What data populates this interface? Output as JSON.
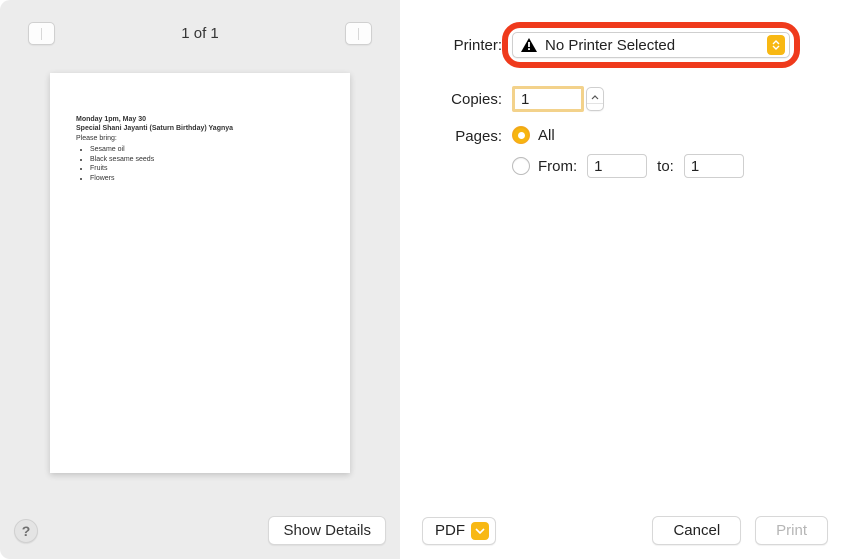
{
  "preview": {
    "page_indicator": "1 of 1",
    "page_content": {
      "line1": "Monday 1pm, May 30",
      "line2": "Special Shani Jayanti (Saturn Birthday) Yagnya",
      "line3": "Please bring:",
      "bullets": [
        "Sesame oil",
        "Black sesame seeds",
        "Fruits",
        "Flowers"
      ]
    }
  },
  "footer_left": {
    "help_symbol": "?",
    "show_details_label": "Show Details"
  },
  "settings": {
    "printer_label": "Printer:",
    "printer_value": "No Printer Selected",
    "copies_label": "Copies:",
    "copies_value": "1",
    "pages_label": "Pages:",
    "pages_all_label": "All",
    "pages_from_label": "From:",
    "pages_from_value": "1",
    "pages_to_label": "to:",
    "pages_to_value": "1"
  },
  "footer_right": {
    "pdf_label": "PDF",
    "cancel_label": "Cancel",
    "print_label": "Print"
  }
}
